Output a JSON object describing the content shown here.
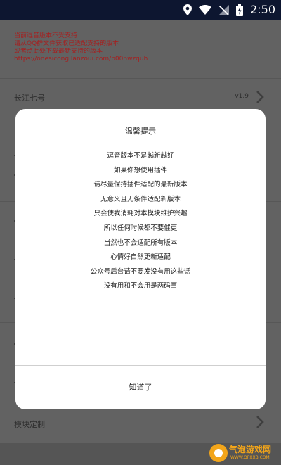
{
  "status_bar": {
    "time": "2:50",
    "icons": [
      "location-icon",
      "wifi-icon",
      "no-signal-icon",
      "battery-charging-icon"
    ]
  },
  "notice": {
    "lines": [
      "当前逗音版本不受支持",
      "请从QQ群文件获取已适配支持的版本",
      "或者点此处下载最新支持的版本",
      "https://onesicong.lanzoui.com/b00nwzquh"
    ],
    "color": "#a52020"
  },
  "rows": [
    {
      "label": "长江七号",
      "version": "v1.9"
    },
    {
      "label": "模块定制"
    }
  ],
  "dialog": {
    "title": "温馨提示",
    "lines": [
      "逗音版本不是越新越好",
      "如果你想使用插件",
      "请尽量保持插件适配的最新版本",
      "无意义且无条件适配新版本",
      "只会使我消耗对本模块维护兴趣",
      "所以任何时候都不要催更",
      "当然也不会适配所有版本",
      "心情好自然更新适配",
      "公众号后台请不要发没有用这些话",
      "没有用和不会用是两码事"
    ],
    "confirm_label": "知道了"
  },
  "watermark": {
    "name": "气泡游戏网",
    "url": "WWW.QPXXB.COM",
    "color": "#f2a51a"
  }
}
